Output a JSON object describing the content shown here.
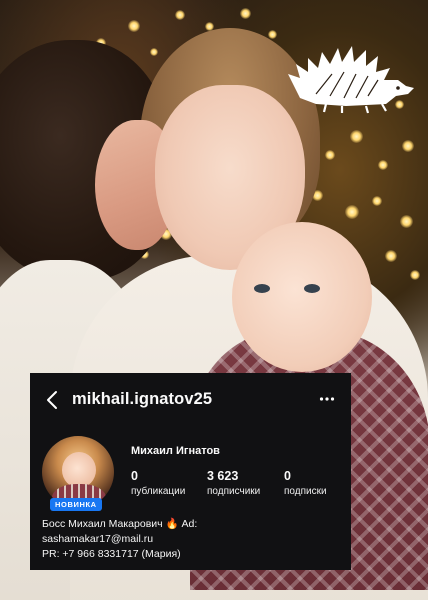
{
  "profile": {
    "username": "mikhail.ignatov25",
    "display_name": "Михаил Игнатов",
    "badge": "НОВИНКА",
    "stats": [
      {
        "value": "0",
        "label": "публикации"
      },
      {
        "value": "3 623",
        "label": "подписчики"
      },
      {
        "value": "0",
        "label": "подписки"
      }
    ],
    "bio_lines": [
      "Босс Михаил Макарович 🔥 Ad:",
      "sashamakar17@mail.ru",
      "PR: +7 966 8331717 (Мария)"
    ]
  },
  "icons": {
    "back": "chevron-left-icon",
    "more": "more-horizontal-icon",
    "logo": "hedgehog-logo"
  },
  "colors": {
    "card_background": "#111113",
    "badge": "#1877f2",
    "text": "#fafafa"
  }
}
